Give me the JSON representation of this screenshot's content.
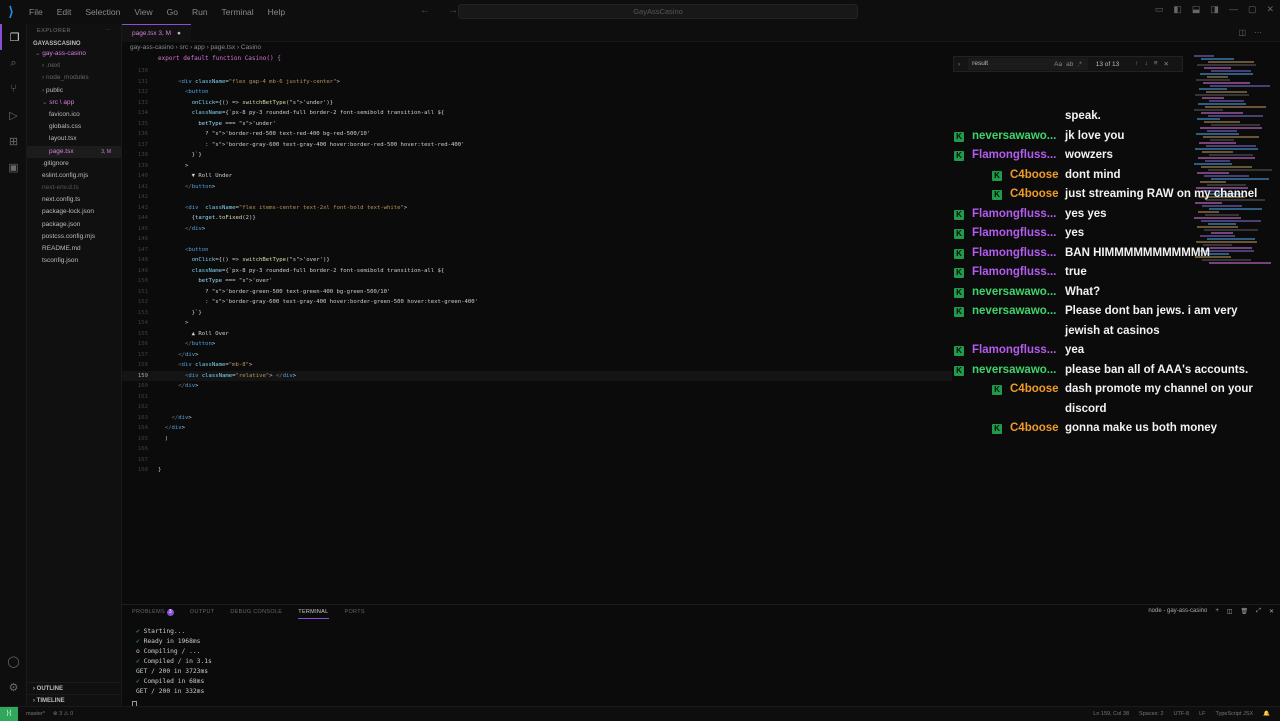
{
  "title_bar": {
    "menu": [
      "File",
      "Edit",
      "Selection",
      "View",
      "Go",
      "Run",
      "Terminal",
      "Help"
    ],
    "search_text": "GayAssCasino"
  },
  "sidebar": {
    "header": "EXPLORER",
    "root": "GAYASSCASINO",
    "tree": [
      {
        "label": "gay-ass-casino",
        "indent": 0,
        "color": "#d57fdc",
        "arrow": "⌄"
      },
      {
        "label": ".next",
        "indent": 1,
        "color": "#666666",
        "arrow": "›"
      },
      {
        "label": "node_modules",
        "indent": 1,
        "color": "#666666",
        "arrow": "›"
      },
      {
        "label": "public",
        "indent": 1,
        "color": "#bbbbbb",
        "arrow": "›"
      },
      {
        "label": "src \\ app",
        "indent": 1,
        "color": "#d57fdc",
        "arrow": "⌄"
      },
      {
        "label": "favicon.ico",
        "indent": 2,
        "color": "#bbbbbb",
        "arrow": ""
      },
      {
        "label": "globals.css",
        "indent": 2,
        "color": "#bbbbbb",
        "arrow": ""
      },
      {
        "label": "layout.tsx",
        "indent": 2,
        "color": "#bbbbbb",
        "arrow": ""
      },
      {
        "label": "page.tsx",
        "indent": 2,
        "color": "#d57fdc",
        "arrow": "",
        "badge": "3, M"
      },
      {
        "label": ".gitignore",
        "indent": 1,
        "color": "#bbbbbb",
        "arrow": ""
      },
      {
        "label": "eslint.config.mjs",
        "indent": 1,
        "color": "#bbbbbb",
        "arrow": ""
      },
      {
        "label": "next-env.d.ts",
        "indent": 1,
        "color": "#555555",
        "arrow": ""
      },
      {
        "label": "next.config.ts",
        "indent": 1,
        "color": "#bbbbbb",
        "arrow": ""
      },
      {
        "label": "package-lock.json",
        "indent": 1,
        "color": "#bbbbbb",
        "arrow": ""
      },
      {
        "label": "package.json",
        "indent": 1,
        "color": "#bbbbbb",
        "arrow": ""
      },
      {
        "label": "postcss.config.mjs",
        "indent": 1,
        "color": "#bbbbbb",
        "arrow": ""
      },
      {
        "label": "README.md",
        "indent": 1,
        "color": "#bbbbbb",
        "arrow": ""
      },
      {
        "label": "tsconfig.json",
        "indent": 1,
        "color": "#bbbbbb",
        "arrow": ""
      }
    ],
    "outline": "OUTLINE",
    "timeline": "TIMELINE"
  },
  "editor": {
    "tab_label": "page.tsx 3, M",
    "breadcrumb": "gay-ass-casino › src › app › page.tsx › Casino",
    "first_line": "export default function Casino() {",
    "find": {
      "query": "result",
      "count": "13 of 13"
    },
    "code_lines": [
      {
        "n": "130",
        "text": ""
      },
      {
        "n": "131",
        "text": "      <div className=\"flex gap-4 mb-6 justify-center\">"
      },
      {
        "n": "132",
        "text": "        <button"
      },
      {
        "n": "133",
        "text": "          onClick={() => switchBetType('under')}"
      },
      {
        "n": "134",
        "text": "          className={`px-8 py-3 rounded-full border-2 font-semibold transition-all ${"
      },
      {
        "n": "135",
        "text": "            betType === 'under'"
      },
      {
        "n": "136",
        "text": "              ? 'border-red-500 text-red-400 bg-red-500/10'"
      },
      {
        "n": "137",
        "text": "              : 'border-gray-600 text-gray-400 hover:border-red-500 hover:text-red-400'"
      },
      {
        "n": "138",
        "text": "          }`}"
      },
      {
        "n": "139",
        "text": "        >"
      },
      {
        "n": "140",
        "text": "          ▼ Roll Under"
      },
      {
        "n": "141",
        "text": "        </button>"
      },
      {
        "n": "142",
        "text": ""
      },
      {
        "n": "143",
        "text": "        <div  className=\"flex items-center text-2xl font-bold text-white\">"
      },
      {
        "n": "144",
        "text": "          {target.toFixed(2)}"
      },
      {
        "n": "145",
        "text": "        </div>"
      },
      {
        "n": "146",
        "text": ""
      },
      {
        "n": "147",
        "text": "        <button"
      },
      {
        "n": "148",
        "text": "          onClick={() => switchBetType('over')}"
      },
      {
        "n": "149",
        "text": "          className={`px-8 py-3 rounded-full border-2 font-semibold transition-all ${"
      },
      {
        "n": "150",
        "text": "            betType === 'over'"
      },
      {
        "n": "151",
        "text": "              ? 'border-green-500 text-green-400 bg-green-500/10'"
      },
      {
        "n": "152",
        "text": "              : 'border-gray-600 text-gray-400 hover:border-green-500 hover:text-green-400'"
      },
      {
        "n": "153",
        "text": "          }`}"
      },
      {
        "n": "154",
        "text": "        >"
      },
      {
        "n": "155",
        "text": "          ▲ Roll Over"
      },
      {
        "n": "156",
        "text": "        </button>"
      },
      {
        "n": "157",
        "text": "      </div>"
      },
      {
        "n": "158",
        "text": "      <div className=\"mb-8\">"
      },
      {
        "n": "159",
        "text": "        <div className=\"relative\"> </div>"
      },
      {
        "n": "160",
        "text": "      </div>"
      },
      {
        "n": "161",
        "text": ""
      },
      {
        "n": "162",
        "text": ""
      },
      {
        "n": "163",
        "text": "    </div>"
      },
      {
        "n": "164",
        "text": "  </div>"
      },
      {
        "n": "165",
        "text": "  )"
      },
      {
        "n": "166",
        "text": ""
      },
      {
        "n": "167",
        "text": ""
      },
      {
        "n": "168",
        "text": "}"
      }
    ]
  },
  "chat": [
    {
      "user": "",
      "text": "speak.",
      "badge": false,
      "user_color": ""
    },
    {
      "user": "neversawawo...",
      "text": "jk love you",
      "badge": true,
      "user_color": "#3fd36b"
    },
    {
      "user": "Flamongfluss...",
      "text": "wowzers",
      "badge": true,
      "user_color": "#b45cf0"
    },
    {
      "user": "C4boose",
      "text": "dont mind",
      "badge": true,
      "user_color": "#f09a2a"
    },
    {
      "user": "C4boose",
      "text": "just streaming RAW on my channel",
      "badge": true,
      "user_color": "#f09a2a"
    },
    {
      "user": "Flamongfluss...",
      "text": "yes yes",
      "badge": true,
      "user_color": "#b45cf0"
    },
    {
      "user": "Flamongfluss...",
      "text": "yes",
      "badge": true,
      "user_color": "#b45cf0"
    },
    {
      "user": "Flamongfluss...",
      "text": "BAN HIMMMMMMMMMMM",
      "badge": true,
      "user_color": "#b45cf0"
    },
    {
      "user": "Flamongfluss...",
      "text": "true",
      "badge": true,
      "user_color": "#b45cf0"
    },
    {
      "user": "neversawawo...",
      "text": "What?",
      "badge": true,
      "user_color": "#3fd36b"
    },
    {
      "user": "neversawawo...",
      "text": "Please dont ban jews. i am very",
      "badge": true,
      "user_color": "#3fd36b"
    },
    {
      "user": "",
      "text": "jewish at casinos",
      "badge": false,
      "user_color": ""
    },
    {
      "user": "Flamongfluss...",
      "text": "yea",
      "badge": true,
      "user_color": "#b45cf0"
    },
    {
      "user": "neversawawo...",
      "text": "please ban all of AAA's accounts.",
      "badge": true,
      "user_color": "#3fd36b"
    },
    {
      "user": "C4boose",
      "text": "dash promote my channel on your",
      "badge": true,
      "user_color": "#f09a2a"
    },
    {
      "user": "",
      "text": "discord",
      "badge": false,
      "user_color": ""
    },
    {
      "user": "C4boose",
      "text": "gonna make us both money",
      "badge": true,
      "user_color": "#f09a2a"
    }
  ],
  "panel": {
    "tabs": [
      "PROBLEMS",
      "OUTPUT",
      "DEBUG CONSOLE",
      "TERMINAL",
      "PORTS"
    ],
    "problems_count": "3",
    "terminal_name": "node - gay-ass-casino",
    "terminal_lines": [
      {
        "mark": "✓",
        "text": "Starting..."
      },
      {
        "mark": "✓",
        "text": "Ready in 1968ms"
      },
      {
        "mark": "o",
        "text": "Compiling / ..."
      },
      {
        "mark": "✓",
        "text": "Compiled / in 3.1s"
      },
      {
        "mark": "",
        "text": "GET / 200 in 3723ms"
      },
      {
        "mark": "✓",
        "text": "Compiled in 68ms"
      },
      {
        "mark": "",
        "text": "GET / 200 in 332ms"
      }
    ]
  },
  "status_bar": {
    "branch": "master*",
    "errors": "⊗ 3 ⚠ 0",
    "position": "Ln 159, Col 38",
    "spaces": "Spaces: 2",
    "encoding": "UTF-8",
    "eol": "LF",
    "language": "TypeScript JSX"
  },
  "colors": {
    "accent": "#8a4fd8",
    "badge_green": "#1f9c4b"
  }
}
